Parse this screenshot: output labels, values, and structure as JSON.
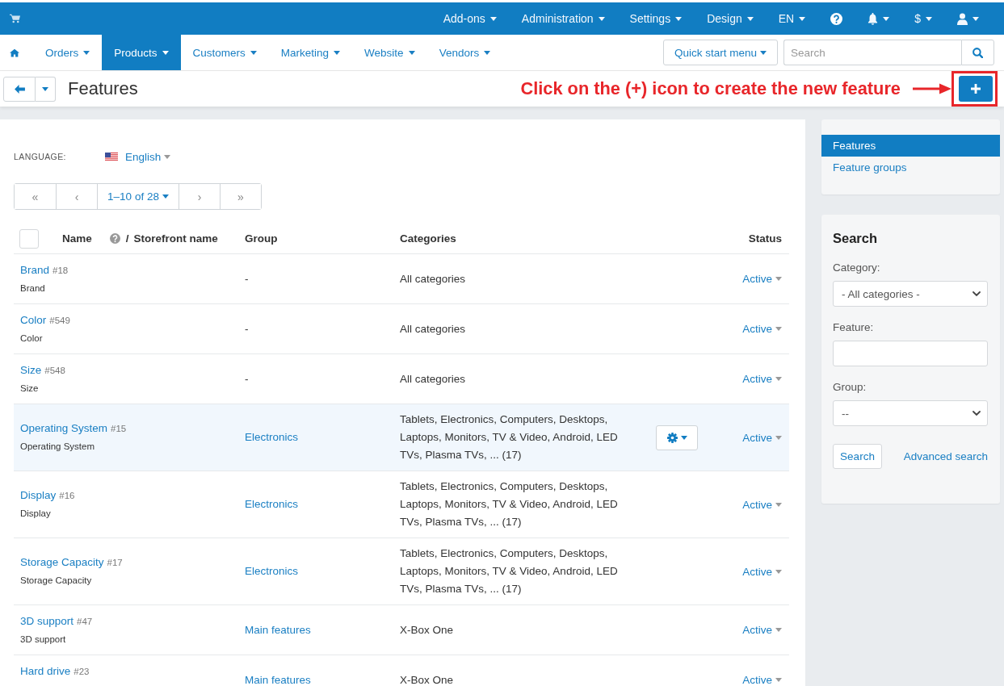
{
  "top_bar": {
    "items": [
      {
        "kind": "menu",
        "label": "Add-ons"
      },
      {
        "kind": "menu",
        "label": "Administration"
      },
      {
        "kind": "menu",
        "label": "Settings"
      },
      {
        "kind": "menu",
        "label": "Design"
      },
      {
        "kind": "menu",
        "label": "EN"
      },
      {
        "kind": "help"
      },
      {
        "kind": "notifications"
      },
      {
        "kind": "menu",
        "label": "$"
      },
      {
        "kind": "account"
      }
    ]
  },
  "nav": {
    "items": [
      {
        "label": "Orders",
        "selected": false
      },
      {
        "label": "Products",
        "selected": true
      },
      {
        "label": "Customers",
        "selected": false
      },
      {
        "label": "Marketing",
        "selected": false
      },
      {
        "label": "Website",
        "selected": false
      },
      {
        "label": "Vendors",
        "selected": false
      }
    ],
    "quick_start": "Quick start menu",
    "search": {
      "placeholder": "Search"
    }
  },
  "title_bar": {
    "title": "Features",
    "annotation": "Click on the (+) icon to create the new feature"
  },
  "language": {
    "label": "LANGUAGE:",
    "value": "English"
  },
  "pagination": [
    {
      "kind": "arrow",
      "text": "«"
    },
    {
      "kind": "arrow",
      "text": "‹"
    },
    {
      "kind": "range",
      "text": "1–10 of 28"
    },
    {
      "kind": "arrow",
      "text": "›"
    },
    {
      "kind": "arrow",
      "text": "»"
    }
  ],
  "table": {
    "header": {
      "select_all_checked": false,
      "name": "Name",
      "separator": "/",
      "storefront_name": "Storefront name",
      "group": "Group",
      "categories": "Categories",
      "status": "Status"
    },
    "rows": [
      {
        "name": "Brand",
        "id": "#18",
        "storefront_name": "Brand",
        "group": {
          "text": "-",
          "link": false
        },
        "categories": "All categories",
        "status": "Active",
        "highlighted": false
      },
      {
        "name": "Color",
        "id": "#549",
        "storefront_name": "Color",
        "group": {
          "text": "-",
          "link": false
        },
        "categories": "All categories",
        "status": "Active",
        "highlighted": false
      },
      {
        "name": "Size",
        "id": "#548",
        "storefront_name": "Size",
        "group": {
          "text": "-",
          "link": false
        },
        "categories": "All categories",
        "status": "Active",
        "highlighted": false
      },
      {
        "name": "Operating System",
        "id": "#15",
        "storefront_name": "Operating System",
        "group": {
          "text": "Electronics",
          "link": true
        },
        "categories": "Tablets, Electronics, Computers, Desktops, Laptops, Monitors, TV & Video, Android, LED TVs, Plasma TVs, ... (17)",
        "status": "Active",
        "highlighted": true
      },
      {
        "name": "Display",
        "id": "#16",
        "storefront_name": "Display",
        "group": {
          "text": "Electronics",
          "link": true
        },
        "categories": "Tablets, Electronics, Computers, Desktops, Laptops, Monitors, TV & Video, Android, LED TVs, Plasma TVs, ... (17)",
        "status": "Active",
        "highlighted": false
      },
      {
        "name": "Storage Capacity",
        "id": "#17",
        "storefront_name": "Storage Capacity",
        "group": {
          "text": "Electronics",
          "link": true
        },
        "categories": "Tablets, Electronics, Computers, Desktops, Laptops, Monitors, TV & Video, Android, LED TVs, Plasma TVs, ... (17)",
        "status": "Active",
        "highlighted": false
      },
      {
        "name": "3D support",
        "id": "#47",
        "storefront_name": "3D support",
        "group": {
          "text": "Main features",
          "link": true
        },
        "categories": "X-Box One",
        "status": "Active",
        "highlighted": false
      },
      {
        "name": "Hard drive",
        "id": "#23",
        "group": {
          "text": "Main features",
          "link": true
        },
        "categories": "X-Box One",
        "status": "Active",
        "highlighted": false
      }
    ]
  },
  "sidebar": {
    "sections": [
      {
        "label": "Features",
        "selected": true
      },
      {
        "label": "Feature groups",
        "selected": false
      }
    ],
    "search": {
      "title": "Search",
      "fields": [
        {
          "kind": "select",
          "label": "Category:",
          "value": "- All categories -"
        },
        {
          "kind": "text",
          "label": "Feature:"
        },
        {
          "kind": "select",
          "label": "Group:",
          "value": "--"
        }
      ],
      "button": "Search",
      "link": "Advanced search"
    }
  }
}
